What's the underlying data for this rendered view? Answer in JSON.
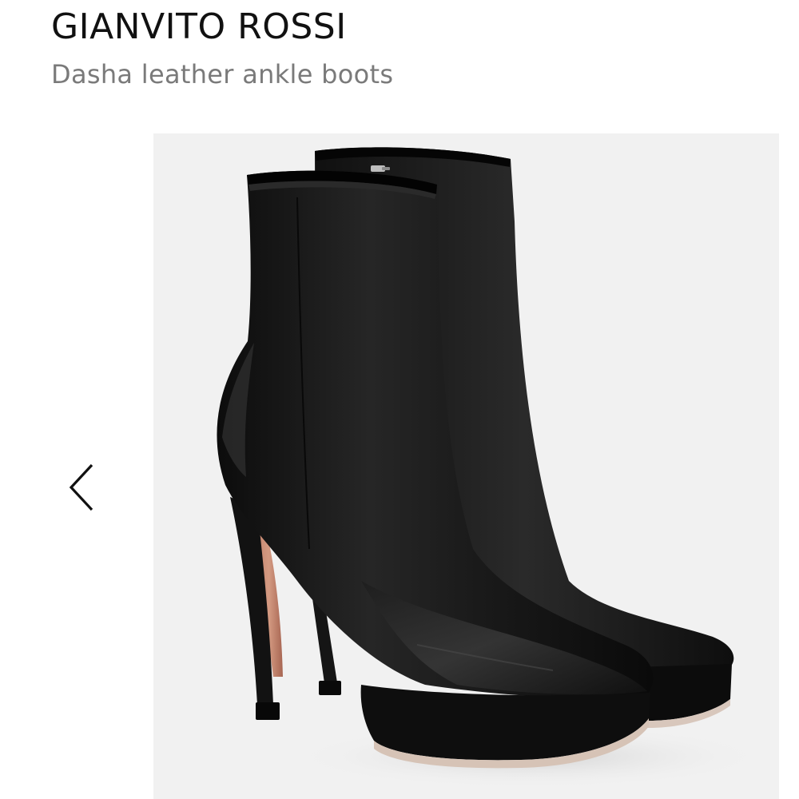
{
  "product": {
    "brand": "GIANVITO ROSSI",
    "name": "Dasha leather ankle boots"
  },
  "gallery": {
    "image_alt": "Dasha leather ankle boots",
    "prev_icon": "chevron-left-icon",
    "background": "#f1f1f1"
  },
  "colors": {
    "brand_text": "#111111",
    "subtitle_text": "#7a7a7a",
    "boot_leather": "#1a1a1a",
    "heel_lining": "#c98a72"
  }
}
